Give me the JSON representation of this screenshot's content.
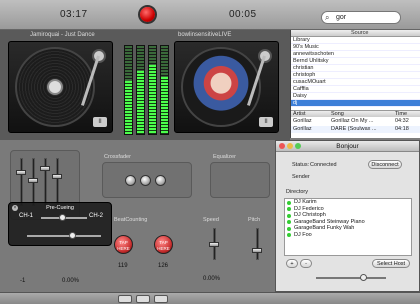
{
  "topbar": {
    "left_time": "03:17",
    "right_time": "00:05",
    "search_value": "gor"
  },
  "decks": {
    "left_title": "Jamiroquai - Just Dance",
    "right_title": "bowlinsensitiveLIVE",
    "left_button": "II",
    "right_button": "II"
  },
  "library": {
    "source_header": "Source",
    "items": [
      "Library",
      "90's Music",
      "annewitsschoten",
      "Bernd Uhlitsky",
      "christian",
      "christoph",
      "cusacMOuart",
      "Cafffia",
      "Daisy",
      "dj"
    ],
    "columns": [
      "Artist",
      "Song",
      "Time"
    ],
    "rows": [
      [
        "Gorillaz",
        "Gorillaz On My ...",
        "04:32"
      ],
      [
        "Gorillaz",
        "DARE (Soulwax ...",
        "04:18"
      ]
    ]
  },
  "mixer": {
    "crossfader_label": "Crossfader",
    "equalizer_label": "Equalizer",
    "beatcounting_label": "BeatCounting",
    "speed_label": "Speed",
    "pitch_label": "Pitch",
    "tap_label": "TAP HERE",
    "bpm_left": "119",
    "bpm_right": "126",
    "left_value": "-1",
    "left_pct": "0.00%",
    "speed_pct": "0.00%"
  },
  "precue": {
    "title": "Pre-Cueing",
    "ch1": "CH-1",
    "ch2": "CH-2"
  },
  "bonjour": {
    "title": "Bonjour",
    "status_label": "Status:",
    "status_value": "Connected",
    "disconnect_label": "Disconnect",
    "sender_label": "Sender",
    "directory_label": "Directory",
    "directory": [
      "DJ Karim",
      "DJ Federico",
      "DJ Christoph",
      "GarageBand Steinway Piano",
      "GarageBand Funky Wah",
      "DJ Foo"
    ],
    "add_label": "+",
    "remove_label": "-",
    "select_host_label": "Select Host"
  }
}
